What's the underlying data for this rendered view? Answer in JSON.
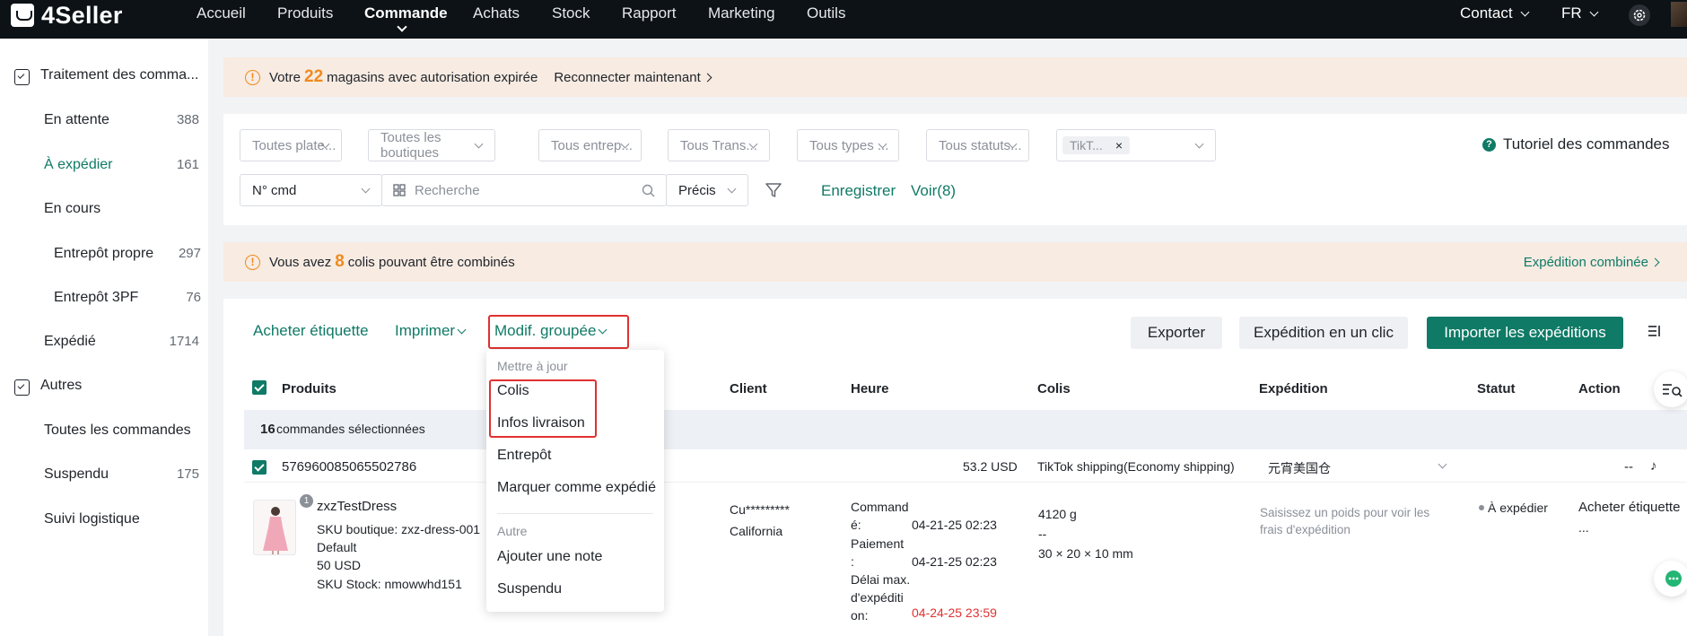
{
  "topbar": {
    "logo": "4Seller",
    "nav": [
      "Accueil",
      "Produits",
      "Commande",
      "Achats",
      "Stock",
      "Rapport",
      "Marketing",
      "Outils"
    ],
    "contact": "Contact",
    "lang": "FR"
  },
  "sidebar": {
    "section1": "Traitement des comma...",
    "items": [
      {
        "label": "En attente",
        "count": "388"
      },
      {
        "label": "À expédier",
        "count": "161"
      },
      {
        "label": "En cours",
        "count": ""
      },
      {
        "label": "Entrepôt propre",
        "count": "297"
      },
      {
        "label": "Entrepôt 3PF",
        "count": "76"
      },
      {
        "label": "Expédié",
        "count": "1714"
      }
    ],
    "section2": "Autres",
    "items2": [
      {
        "label": "Toutes les commandes",
        "count": ""
      },
      {
        "label": "Suspendu",
        "count": "175"
      },
      {
        "label": "Suivi logistique",
        "count": ""
      }
    ]
  },
  "banner1": {
    "pre": "Votre",
    "num": "22",
    "post": "magasins avec autorisation expirée",
    "action": "Reconnecter maintenant"
  },
  "filters": {
    "selects": [
      "Toutes plate...",
      "Toutes les boutiques",
      "Tous entrep...",
      "Tous Trans...",
      "Tous types ...",
      "Tous statuts..."
    ],
    "tag": "TikT...",
    "tutorial": "Tutoriel des commandes",
    "field": "N° cmd",
    "search_placeholder": "Recherche",
    "mode": "Précis",
    "save": "Enregistrer",
    "view": "Voir(8)"
  },
  "banner2": {
    "pre": "Vous avez",
    "num": "8",
    "post": "colis pouvant être combinés",
    "action": "Expédition combinée"
  },
  "toolbar": {
    "buy_label": "Acheter étiquette",
    "print": "Imprimer",
    "bulk": "Modif. groupée",
    "export": "Exporter",
    "oneclick": "Expédition en un clic",
    "import": "Importer les expéditions"
  },
  "table": {
    "headers": [
      "Produits",
      "Client",
      "Heure",
      "Colis",
      "Expédition",
      "Statut",
      "Action"
    ],
    "selected_count": "16",
    "selected_text": "commandes sélectionnées",
    "order": {
      "id": "576960085065502786",
      "amount": "53.2 USD",
      "shipping": "TikTok shipping(Economy shipping)",
      "warehouse": "元宵美国仓",
      "dash": "--",
      "product_badge": "1",
      "product": "zxzTestDress",
      "sku": "SKU boutique: zxz-dress-001",
      "variant": "Default",
      "price": "50 USD",
      "sku_stock": "SKU Stock: nmowwhd151",
      "client_name": "Cu*********",
      "client_region": "California",
      "time_order_label_1": "Command",
      "time_order_label_2": "é:",
      "time_order": "04-21-25 02:23",
      "time_pay_label_1": "Paiement",
      "time_pay_label_2": ":",
      "time_pay": "04-21-25 02:23",
      "time_max_label_1": "Délai max.",
      "time_max_label_2": "d'expéditi",
      "time_max_label_3": "on:",
      "time_max": "04-24-25 23:59",
      "weight": "4120 g",
      "weight_dash": "--",
      "dims": "30 × 20 × 10 mm",
      "ship_hint_1": "Saisissez un poids pour voir les",
      "ship_hint_2": "frais d'expédition",
      "status": "À expédier",
      "action": "Acheter étiquette",
      "action_more": "..."
    }
  },
  "dropdown": {
    "group1": "Mettre à jour",
    "items1": [
      "Colis",
      "Infos livraison",
      "Entrepôt",
      "Marquer comme expédié"
    ],
    "group2": "Autre",
    "items2": [
      "Ajouter une note",
      "Suspendu"
    ]
  }
}
